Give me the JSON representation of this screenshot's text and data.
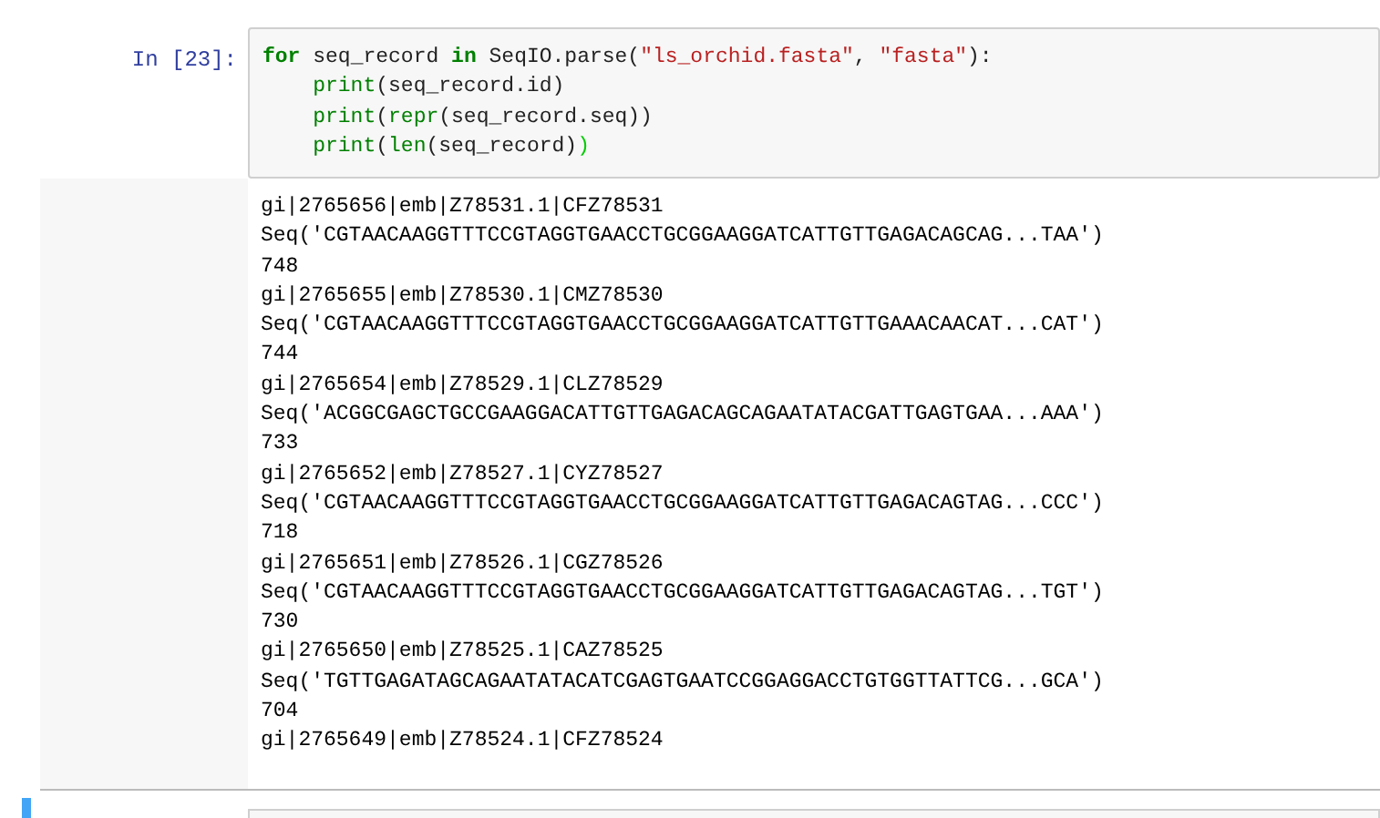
{
  "input_cell": {
    "prompt": "In [23]:",
    "code": [
      {
        "indented": false,
        "tokens": [
          {
            "kind": "keyword",
            "text": "for"
          },
          {
            "kind": "plain",
            "text": " seq_record "
          },
          {
            "kind": "keyword",
            "text": "in"
          },
          {
            "kind": "plain",
            "text": " SeqIO.parse("
          },
          {
            "kind": "string",
            "text": "\"ls_orchid.fasta\""
          },
          {
            "kind": "plain",
            "text": ", "
          },
          {
            "kind": "string",
            "text": "\"fasta\""
          },
          {
            "kind": "plain",
            "text": "):"
          }
        ]
      },
      {
        "indented": true,
        "tokens": [
          {
            "kind": "builtin",
            "text": "print"
          },
          {
            "kind": "plain",
            "text": "(seq_record.id)"
          }
        ]
      },
      {
        "indented": true,
        "tokens": [
          {
            "kind": "builtin",
            "text": "print"
          },
          {
            "kind": "plain",
            "text": "("
          },
          {
            "kind": "builtin",
            "text": "repr"
          },
          {
            "kind": "plain",
            "text": "(seq_record.seq))"
          }
        ]
      },
      {
        "indented": true,
        "tokens": [
          {
            "kind": "builtin",
            "text": "print"
          },
          {
            "kind": "plain",
            "text": "("
          },
          {
            "kind": "builtin",
            "text": "len"
          },
          {
            "kind": "plain",
            "text": "(seq_record)"
          },
          {
            "kind": "match",
            "text": ")"
          }
        ]
      }
    ]
  },
  "output": [
    "gi|2765656|emb|Z78531.1|CFZ78531",
    "Seq('CGTAACAAGGTTTCCGTAGGTGAACCTGCGGAAGGATCATTGTTGAGACAGCAG...TAA')",
    "748",
    "gi|2765655|emb|Z78530.1|CMZ78530",
    "Seq('CGTAACAAGGTTTCCGTAGGTGAACCTGCGGAAGGATCATTGTTGAAACAACAT...CAT')",
    "744",
    "gi|2765654|emb|Z78529.1|CLZ78529",
    "Seq('ACGGCGAGCTGCCGAAGGACATTGTTGAGACAGCAGAATATACGATTGAGTGAA...AAA')",
    "733",
    "gi|2765652|emb|Z78527.1|CYZ78527",
    "Seq('CGTAACAAGGTTTCCGTAGGTGAACCTGCGGAAGGATCATTGTTGAGACAGTAG...CCC')",
    "718",
    "gi|2765651|emb|Z78526.1|CGZ78526",
    "Seq('CGTAACAAGGTTTCCGTAGGTGAACCTGCGGAAGGATCATTGTTGAGACAGTAG...TGT')",
    "730",
    "gi|2765650|emb|Z78525.1|CAZ78525",
    "Seq('TGTTGAGATAGCAGAATATACATCGAGTGAATCCGGAGGACCTGTGGTTATTCG...GCA')",
    "704",
    "gi|2765649|emb|Z78524.1|CFZ78524"
  ],
  "next_cell": {
    "selected": true
  }
}
